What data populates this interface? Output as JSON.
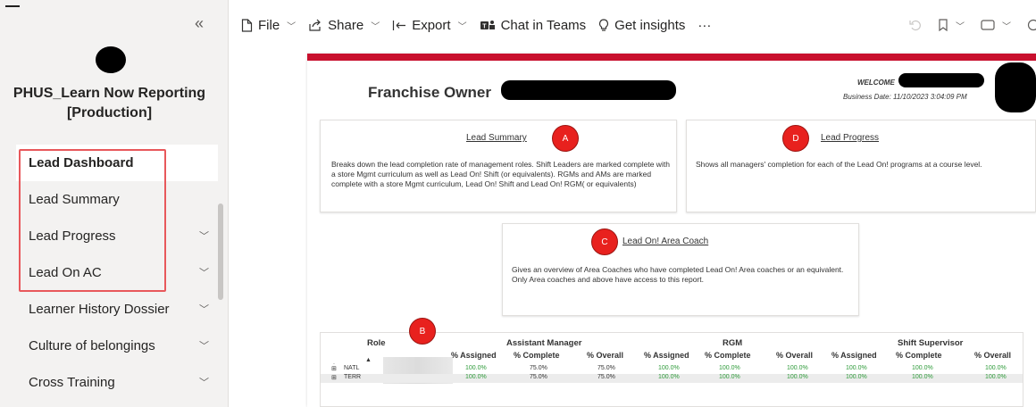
{
  "sidebar": {
    "collapse_glyph": "«",
    "workspace_title": "PHUS_Learn Now Reporting [Production]",
    "items": [
      {
        "label": "Lead Dashboard",
        "active": true,
        "has_children": false
      },
      {
        "label": "Lead Summary",
        "active": false,
        "has_children": false
      },
      {
        "label": "Lead Progress",
        "active": false,
        "has_children": true
      },
      {
        "label": "Lead On AC",
        "active": false,
        "has_children": true
      },
      {
        "label": "Learner History Dossier",
        "active": false,
        "has_children": true
      },
      {
        "label": "Culture of belongings",
        "active": false,
        "has_children": true
      },
      {
        "label": "Cross Training",
        "active": false,
        "has_children": true
      }
    ]
  },
  "toolbar": {
    "file": "File",
    "share": "Share",
    "export": "Export",
    "chat": "Chat in Teams",
    "insights": "Get insights",
    "more": "···"
  },
  "report": {
    "title": "Franchise Owner",
    "welcome": "WELCOME",
    "business_date": "Business Date: 11/10/2023 3:04:09 PM",
    "cards": {
      "summary": {
        "title": "Lead Summary",
        "marker": "A",
        "desc": "Breaks down the lead completion rate of management roles. Shift Leaders are marked complete with a store Mgmt curriculum as well as Lead On! Shift (or equivalents). RGMs and AMs are marked complete with a store Mgmt curriculum, Lead On! Shift and Lead On! RGM( or equivalents)"
      },
      "progress": {
        "title": "Lead Progress",
        "marker": "D",
        "desc": "Shows all managers' completion for each of the Lead On! programs at a course level."
      },
      "area_coach": {
        "title": "Lead On! Area Coach",
        "marker": "C",
        "desc": "Gives an overview of Area Coaches who have completed Lead On! Area coaches or an equivalent. Only Area coaches and above have access to this report."
      }
    },
    "table": {
      "marker": "B",
      "role_header": "Role",
      "groups": [
        "Assistant Manager",
        "RGM",
        "Shift Supervisor"
      ],
      "subheaders": [
        "% Assigned",
        "% Complete",
        "% Overall",
        "% Assigned",
        "% Complete",
        "% Overall",
        "% Assigned",
        "% Complete",
        "% Overall"
      ],
      "rows": [
        {
          "expand": "⊞",
          "role": "NATL",
          "values": [
            "100.0%",
            "75.0%",
            "75.0%",
            "100.0%",
            "100.0%",
            "100.0%",
            "100.0%",
            "100.0%",
            "100.0%"
          ]
        },
        {
          "expand": "⊞",
          "role": "TERR",
          "values": [
            "100.0%",
            "75.0%",
            "75.0%",
            "100.0%",
            "100.0%",
            "100.0%",
            "100.0%",
            "100.0%",
            "100.0%"
          ]
        }
      ]
    }
  },
  "colors": {
    "accent_red": "#c8102e",
    "marker_red": "#e8211e",
    "highlight_red": "#e8585b",
    "value_green": "#2e9b3a"
  }
}
